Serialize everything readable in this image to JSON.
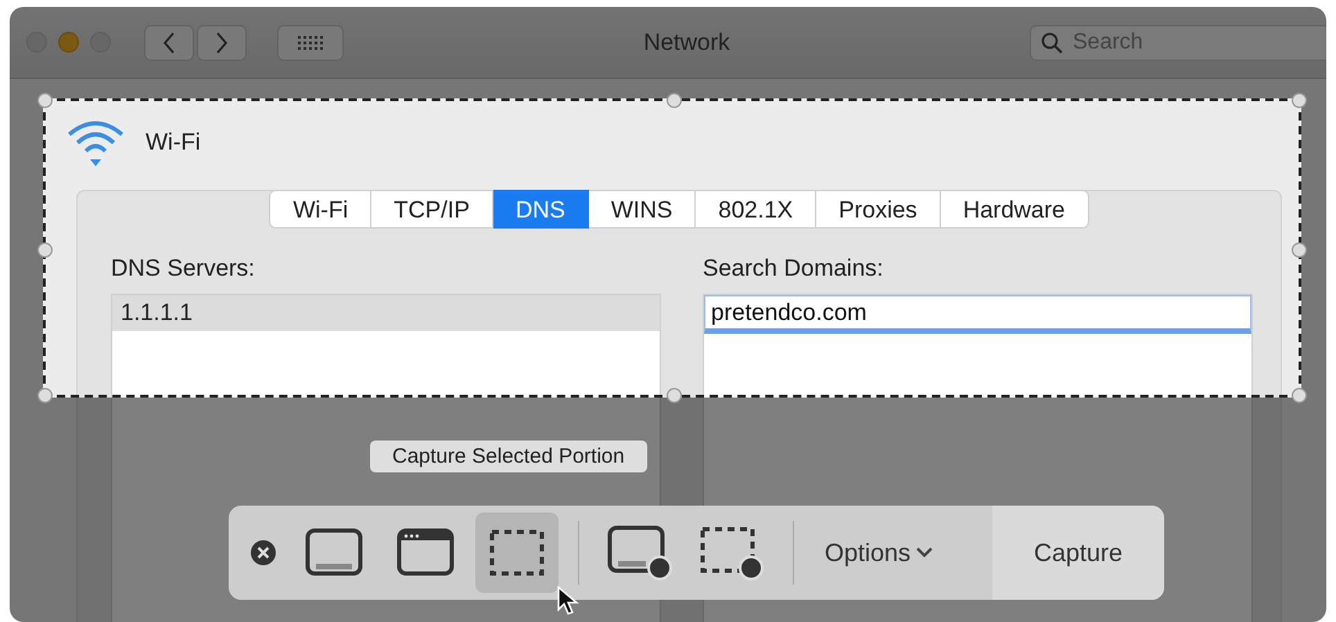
{
  "window": {
    "title": "Network",
    "search": {
      "placeholder": "Search"
    }
  },
  "service": {
    "name": "Wi-Fi"
  },
  "tabs": [
    {
      "label": "Wi-Fi",
      "selected": false
    },
    {
      "label": "TCP/IP",
      "selected": false
    },
    {
      "label": "DNS",
      "selected": true
    },
    {
      "label": "WINS",
      "selected": false
    },
    {
      "label": "802.1X",
      "selected": false
    },
    {
      "label": "Proxies",
      "selected": false
    },
    {
      "label": "Hardware",
      "selected": false
    }
  ],
  "dns_servers": {
    "label": "DNS Servers:",
    "items": [
      {
        "text": "1.1.1.1",
        "selected": true
      }
    ]
  },
  "search_domains": {
    "label": "Search Domains:",
    "value": "pretendco.com"
  },
  "tooltip": "Capture Selected Portion",
  "toolbar": {
    "tools": [
      {
        "kind": "close"
      },
      {
        "kind": "capture-screen",
        "selected": false
      },
      {
        "kind": "capture-window",
        "selected": false
      },
      {
        "kind": "capture-selection",
        "selected": true
      },
      {
        "kind": "divider"
      },
      {
        "kind": "record-screen",
        "selected": false
      },
      {
        "kind": "record-selection",
        "selected": false
      }
    ],
    "options": "Options",
    "capture": "Capture"
  }
}
